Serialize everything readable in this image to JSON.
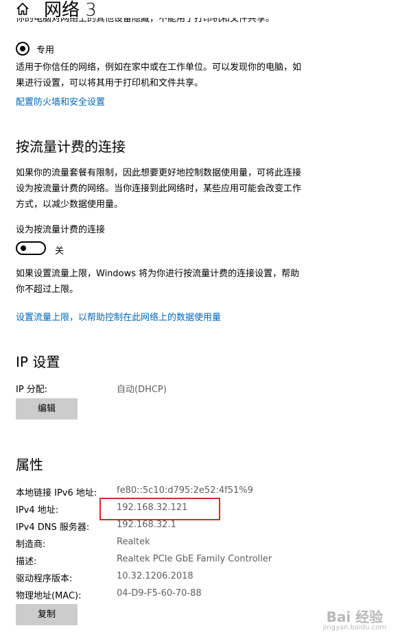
{
  "header": {
    "title": "网络 3",
    "home_icon": "home-icon"
  },
  "private_network": {
    "cut_off_text": "你的电脑对网络上的其他设备隐藏，不能用于打印机和文件共享。",
    "radio_label": "专用",
    "radio_selected": true,
    "description_line1": "适用于你信任的网络，例如在家中或在工作单位。可以发现你的电脑，如",
    "description_line2": "果进行设置，可以将其用于打印机和文件共享。",
    "firewall_link": "配置防火墙和安全设置"
  },
  "metered": {
    "heading": "按流量计费的连接",
    "description_line1": "如果你的流量套餐有限制，因此想要更好地控制数据使用量，可将此连接",
    "description_line2": "设为按流量计费的网络。当你连接到此网络时，某些应用可能会改变工作",
    "description_line3": "方式，以减少数据使用量。",
    "toggle_label": "设为按流量计费的连接",
    "toggle_state": "关",
    "toggle_on": false,
    "limit_line1": "如果设置流量上限，Windows 将为你进行按流量计费的连接设置，帮助",
    "limit_line2": "你不超过上限。",
    "limit_link": "设置流量上限，以帮助控制在此网络上的数据使用量"
  },
  "ip_settings": {
    "heading": "IP 设置",
    "assignment_label": "IP 分配:",
    "assignment_value": "自动(DHCP)",
    "edit_button": "编辑"
  },
  "properties": {
    "heading": "属性",
    "rows": [
      {
        "label": "本地链接 IPv6 地址:",
        "value": "fe80::5c10:d795:2e52:4f51%9"
      },
      {
        "label": "IPv4 地址:",
        "value": "192.168.32.121"
      },
      {
        "label": "IPv4 DNS 服务器:",
        "value": "192.168.32.1"
      },
      {
        "label": "制造商:",
        "value": "Realtek"
      },
      {
        "label": "描述:",
        "value": "Realtek PCIe GbE Family Controller"
      },
      {
        "label": "驱动程序版本:",
        "value": "10.32.1206.2018"
      },
      {
        "label": "物理地址(MAC):",
        "value": "04-D9-F5-60-70-88"
      }
    ],
    "copy_button": "复制"
  },
  "watermark": {
    "main": "Bai 经验",
    "sub": "jingyan.baidu.com"
  },
  "colors": {
    "link": "#0067b8",
    "button_bg": "#cccccc",
    "highlight": "#d42a2a",
    "value_text": "#5e5e5e"
  }
}
